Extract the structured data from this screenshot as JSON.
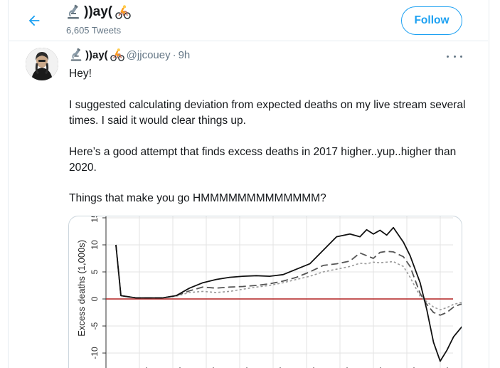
{
  "header": {
    "name": "))ay(",
    "tweet_count": "6,605 Tweets",
    "follow_label": "Follow"
  },
  "tweet": {
    "name": "))ay(",
    "handle": "@jjcouey",
    "dot": "·",
    "time": "9h",
    "paragraphs": [
      "Hey!",
      "I suggested calculating deviation from expected deaths on my live stream several times. I said it would clear things up.",
      "Here’s a good attempt that finds excess deaths in 2017 higher..yup..higher than 2020.",
      "Things that make you go HMMMMMMMMMMMMM?"
    ]
  },
  "icons": {
    "back": "back-arrow-icon",
    "microscope": "microscope-emoji-icon",
    "cyclist": "cyclist-emoji-icon",
    "more": "more-dots-icon"
  },
  "colors": {
    "accent": "#1da1f2",
    "zero_line": "#b22222",
    "muted": "#657786"
  },
  "chart_data": {
    "type": "line",
    "ylabel": "Excess deaths (1,000s)",
    "ytick_labels": [
      "-10",
      "-5",
      "0",
      "5",
      "10",
      "15"
    ],
    "yticks": [
      -10,
      -5,
      0,
      5,
      10,
      15
    ],
    "ylim": [
      -13,
      16
    ],
    "xlim": [
      0,
      100
    ],
    "x_axis_labels_visible": false,
    "grid": true,
    "reference_line": 0,
    "series": [
      {
        "style": "solid",
        "points": [
          [
            0,
            10
          ],
          [
            1.5,
            0.6
          ],
          [
            6,
            0.2
          ],
          [
            14,
            0.2
          ],
          [
            18,
            0.6
          ],
          [
            22,
            2
          ],
          [
            26,
            3
          ],
          [
            30,
            3.6
          ],
          [
            34,
            4
          ],
          [
            38,
            4.2
          ],
          [
            42,
            4.3
          ],
          [
            46,
            4.2
          ],
          [
            50,
            4.5
          ],
          [
            54,
            5.5
          ],
          [
            58,
            6.5
          ],
          [
            62,
            9
          ],
          [
            66,
            11.5
          ],
          [
            70,
            12
          ],
          [
            73,
            11.5
          ],
          [
            75,
            12.8
          ],
          [
            77,
            12
          ],
          [
            79,
            12.7
          ],
          [
            81,
            11.8
          ],
          [
            83,
            13.2
          ],
          [
            86,
            10.5
          ],
          [
            88,
            8
          ],
          [
            91,
            3
          ],
          [
            93,
            -2
          ],
          [
            95,
            -8
          ],
          [
            97,
            -11.5
          ],
          [
            99,
            -9.5
          ],
          [
            101,
            -7
          ],
          [
            103,
            -5.5
          ],
          [
            105,
            -4
          ],
          [
            107,
            -2.5
          ]
        ]
      },
      {
        "style": "long-dash",
        "points": [
          [
            0,
            10
          ],
          [
            1.5,
            0.6
          ],
          [
            6,
            0.2
          ],
          [
            14,
            0.2
          ],
          [
            18,
            0.6
          ],
          [
            22,
            1.5
          ],
          [
            26,
            2.2
          ],
          [
            30,
            2
          ],
          [
            34,
            2.2
          ],
          [
            38,
            2.3
          ],
          [
            42,
            2.5
          ],
          [
            46,
            2.8
          ],
          [
            50,
            3.3
          ],
          [
            54,
            4
          ],
          [
            58,
            5
          ],
          [
            62,
            6.2
          ],
          [
            66,
            6.5
          ],
          [
            70,
            7
          ],
          [
            73,
            8.5
          ],
          [
            75,
            8
          ],
          [
            77,
            7.5
          ],
          [
            79,
            8.6
          ],
          [
            81,
            8.8
          ],
          [
            83,
            8.7
          ],
          [
            86,
            7.8
          ],
          [
            88,
            6
          ],
          [
            91,
            1
          ],
          [
            93,
            -1
          ],
          [
            95,
            -2.5
          ],
          [
            97,
            -3
          ],
          [
            99,
            -2.5
          ],
          [
            101,
            -1.5
          ],
          [
            103,
            -1
          ],
          [
            105,
            -0.8
          ],
          [
            107,
            -0.5
          ]
        ]
      },
      {
        "style": "dotted",
        "points": [
          [
            0,
            10
          ],
          [
            1.5,
            0.6
          ],
          [
            6,
            0.2
          ],
          [
            14,
            0.2
          ],
          [
            18,
            0.5
          ],
          [
            22,
            1.2
          ],
          [
            26,
            1.4
          ],
          [
            30,
            1.2
          ],
          [
            34,
            1.4
          ],
          [
            38,
            1.8
          ],
          [
            42,
            2.2
          ],
          [
            46,
            2.5
          ],
          [
            50,
            3
          ],
          [
            54,
            3.6
          ],
          [
            58,
            4.2
          ],
          [
            62,
            5
          ],
          [
            66,
            5.5
          ],
          [
            70,
            6
          ],
          [
            73,
            6.6
          ],
          [
            75,
            6.5
          ],
          [
            77,
            6.8
          ],
          [
            79,
            6.7
          ],
          [
            81,
            6.8
          ],
          [
            83,
            6.9
          ],
          [
            86,
            6
          ],
          [
            88,
            4
          ],
          [
            91,
            0.5
          ],
          [
            93,
            -0.5
          ],
          [
            95,
            -1.5
          ],
          [
            97,
            -2
          ],
          [
            99,
            -1.6
          ],
          [
            101,
            -1
          ],
          [
            103,
            -0.7
          ],
          [
            105,
            -0.5
          ],
          [
            107,
            -0.4
          ]
        ]
      }
    ]
  }
}
